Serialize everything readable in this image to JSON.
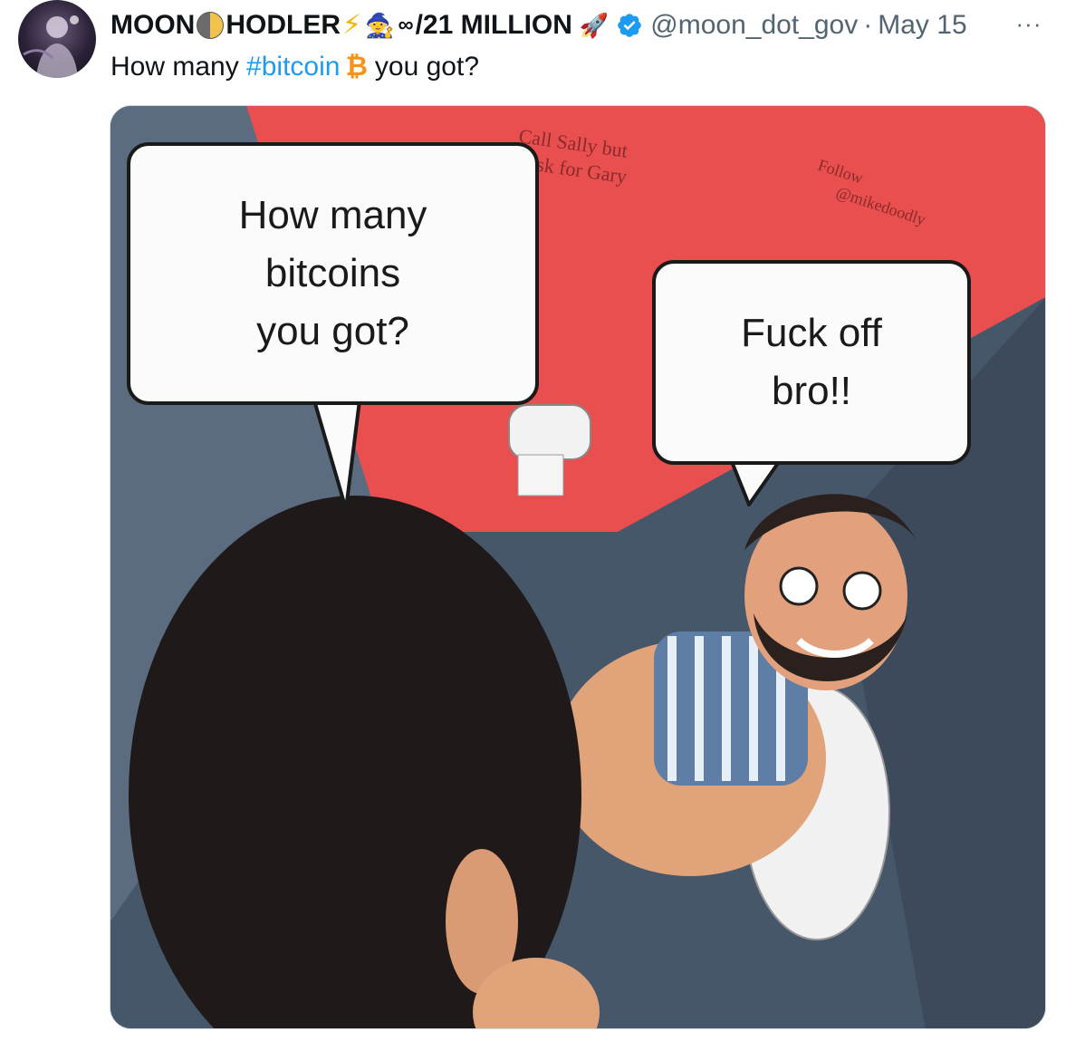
{
  "tweet": {
    "author": {
      "name_part1": "MOON",
      "name_part2": "HODLER",
      "name_part3": "/21 MILLION",
      "emoji_bolt": "⚡",
      "emoji_mage": "🧙",
      "emoji_infinity": "∞",
      "emoji_rocket": "🚀",
      "handle": "@moon_dot_gov",
      "verified": true
    },
    "separator": "·",
    "date": "May 15",
    "more_label": "···",
    "text": {
      "before": "How many ",
      "hashtag": "#bitcoin",
      "btc_symbol": "₿",
      "after": "you got?"
    },
    "media": {
      "bubble_left_lines": [
        "How many",
        "bitcoins",
        "you got?"
      ],
      "bubble_right_lines": [
        "Fuck off",
        "bro!!"
      ],
      "wall_graffiti": [
        "Call Sally but",
        "ask for Gary",
        "Follow",
        "@mikedoodly"
      ]
    }
  },
  "colors": {
    "text_primary": "#0f1419",
    "text_secondary": "#536471",
    "link": "#1d9bf0",
    "bitcoin": "#f7931a",
    "verified": "#1d9bf0",
    "wall_red": "#e94f4f",
    "floor": "#47576a"
  }
}
